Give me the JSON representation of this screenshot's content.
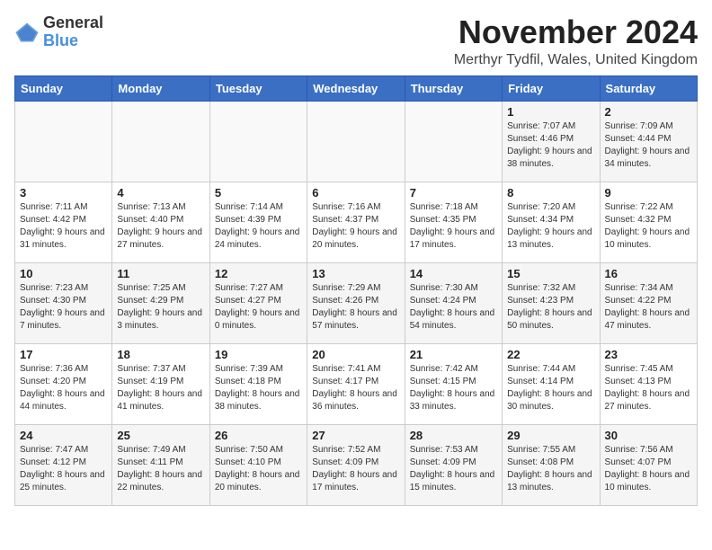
{
  "logo": {
    "general": "General",
    "blue": "Blue"
  },
  "title": "November 2024",
  "subtitle": "Merthyr Tydfil, Wales, United Kingdom",
  "days_of_week": [
    "Sunday",
    "Monday",
    "Tuesday",
    "Wednesday",
    "Thursday",
    "Friday",
    "Saturday"
  ],
  "weeks": [
    [
      {
        "day": "",
        "info": ""
      },
      {
        "day": "",
        "info": ""
      },
      {
        "day": "",
        "info": ""
      },
      {
        "day": "",
        "info": ""
      },
      {
        "day": "",
        "info": ""
      },
      {
        "day": "1",
        "info": "Sunrise: 7:07 AM\nSunset: 4:46 PM\nDaylight: 9 hours and 38 minutes."
      },
      {
        "day": "2",
        "info": "Sunrise: 7:09 AM\nSunset: 4:44 PM\nDaylight: 9 hours and 34 minutes."
      }
    ],
    [
      {
        "day": "3",
        "info": "Sunrise: 7:11 AM\nSunset: 4:42 PM\nDaylight: 9 hours and 31 minutes."
      },
      {
        "day": "4",
        "info": "Sunrise: 7:13 AM\nSunset: 4:40 PM\nDaylight: 9 hours and 27 minutes."
      },
      {
        "day": "5",
        "info": "Sunrise: 7:14 AM\nSunset: 4:39 PM\nDaylight: 9 hours and 24 minutes."
      },
      {
        "day": "6",
        "info": "Sunrise: 7:16 AM\nSunset: 4:37 PM\nDaylight: 9 hours and 20 minutes."
      },
      {
        "day": "7",
        "info": "Sunrise: 7:18 AM\nSunset: 4:35 PM\nDaylight: 9 hours and 17 minutes."
      },
      {
        "day": "8",
        "info": "Sunrise: 7:20 AM\nSunset: 4:34 PM\nDaylight: 9 hours and 13 minutes."
      },
      {
        "day": "9",
        "info": "Sunrise: 7:22 AM\nSunset: 4:32 PM\nDaylight: 9 hours and 10 minutes."
      }
    ],
    [
      {
        "day": "10",
        "info": "Sunrise: 7:23 AM\nSunset: 4:30 PM\nDaylight: 9 hours and 7 minutes."
      },
      {
        "day": "11",
        "info": "Sunrise: 7:25 AM\nSunset: 4:29 PM\nDaylight: 9 hours and 3 minutes."
      },
      {
        "day": "12",
        "info": "Sunrise: 7:27 AM\nSunset: 4:27 PM\nDaylight: 9 hours and 0 minutes."
      },
      {
        "day": "13",
        "info": "Sunrise: 7:29 AM\nSunset: 4:26 PM\nDaylight: 8 hours and 57 minutes."
      },
      {
        "day": "14",
        "info": "Sunrise: 7:30 AM\nSunset: 4:24 PM\nDaylight: 8 hours and 54 minutes."
      },
      {
        "day": "15",
        "info": "Sunrise: 7:32 AM\nSunset: 4:23 PM\nDaylight: 8 hours and 50 minutes."
      },
      {
        "day": "16",
        "info": "Sunrise: 7:34 AM\nSunset: 4:22 PM\nDaylight: 8 hours and 47 minutes."
      }
    ],
    [
      {
        "day": "17",
        "info": "Sunrise: 7:36 AM\nSunset: 4:20 PM\nDaylight: 8 hours and 44 minutes."
      },
      {
        "day": "18",
        "info": "Sunrise: 7:37 AM\nSunset: 4:19 PM\nDaylight: 8 hours and 41 minutes."
      },
      {
        "day": "19",
        "info": "Sunrise: 7:39 AM\nSunset: 4:18 PM\nDaylight: 8 hours and 38 minutes."
      },
      {
        "day": "20",
        "info": "Sunrise: 7:41 AM\nSunset: 4:17 PM\nDaylight: 8 hours and 36 minutes."
      },
      {
        "day": "21",
        "info": "Sunrise: 7:42 AM\nSunset: 4:15 PM\nDaylight: 8 hours and 33 minutes."
      },
      {
        "day": "22",
        "info": "Sunrise: 7:44 AM\nSunset: 4:14 PM\nDaylight: 8 hours and 30 minutes."
      },
      {
        "day": "23",
        "info": "Sunrise: 7:45 AM\nSunset: 4:13 PM\nDaylight: 8 hours and 27 minutes."
      }
    ],
    [
      {
        "day": "24",
        "info": "Sunrise: 7:47 AM\nSunset: 4:12 PM\nDaylight: 8 hours and 25 minutes."
      },
      {
        "day": "25",
        "info": "Sunrise: 7:49 AM\nSunset: 4:11 PM\nDaylight: 8 hours and 22 minutes."
      },
      {
        "day": "26",
        "info": "Sunrise: 7:50 AM\nSunset: 4:10 PM\nDaylight: 8 hours and 20 minutes."
      },
      {
        "day": "27",
        "info": "Sunrise: 7:52 AM\nSunset: 4:09 PM\nDaylight: 8 hours and 17 minutes."
      },
      {
        "day": "28",
        "info": "Sunrise: 7:53 AM\nSunset: 4:09 PM\nDaylight: 8 hours and 15 minutes."
      },
      {
        "day": "29",
        "info": "Sunrise: 7:55 AM\nSunset: 4:08 PM\nDaylight: 8 hours and 13 minutes."
      },
      {
        "day": "30",
        "info": "Sunrise: 7:56 AM\nSunset: 4:07 PM\nDaylight: 8 hours and 10 minutes."
      }
    ]
  ]
}
